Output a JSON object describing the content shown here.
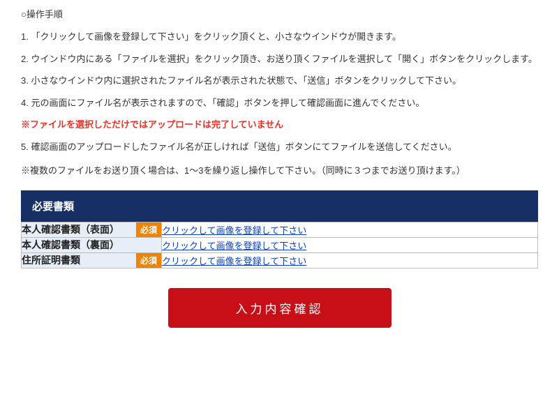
{
  "heading": "○操作手順",
  "steps": {
    "s1": "1. 「クリックして画像を登録して下さい」をクリック頂くと、小さなウインドウが開きます。",
    "s2": "2. ウインドウ内にある「ファイルを選択」をクリック頂き、お送り頂くファイルを選択して「開く」ボタンをクリックします。",
    "s3": "3. 小さなウインドウ内に選択されたファイル名が表示された状態で、「送信」ボタンをクリックして下さい。",
    "s4": "4. 元の画面にファイル名が表示されますので、「確認」ボタンを押して確認画面に進んでください。",
    "warn": "※ファイルを選択しただけではアップロードは完了していません",
    "s5": "5. 確認画面のアップロードしたファイル名が正しければ「送信」ボタンにてファイルを送信してください。"
  },
  "note": "※複数のファイルをお送り頂く場合は、1〜3を繰り返し操作して下さい。（同時に３つまでお送り頂けます。）",
  "section_title": "必要書類",
  "badge_required": "必須",
  "rows": {
    "r1_label": "本人確認書類（表面）",
    "r2_label": "本人確認書類（裏面）",
    "r3_label": "住所証明書類"
  },
  "upload_link_text": "クリックして画像を登録して下さい",
  "confirm_button": "入力内容確認"
}
